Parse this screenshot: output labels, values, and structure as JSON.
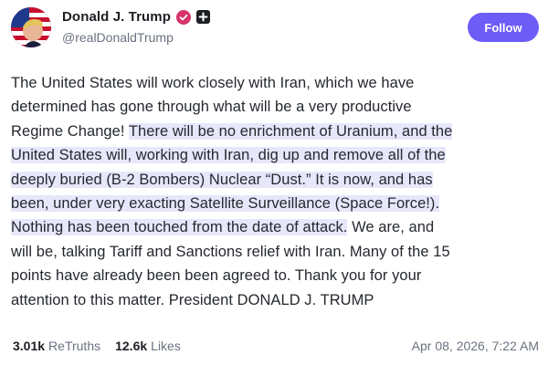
{
  "author": {
    "display_name": "Donald J. Trump",
    "handle": "@realDonaldTrump",
    "verified_icon": "verified-badge-icon",
    "group_icon": "plus-badge-icon"
  },
  "follow_label": "Follow",
  "post": {
    "lines": [
      {
        "pre": "The United States will work closely with Iran, which we have",
        "hl": "",
        "post": ""
      },
      {
        "pre": "determined has gone through what will be a very productive",
        "hl": "",
        "post": ""
      },
      {
        "pre": "Regime Change! ",
        "hl": "There will be no enrichment of Uranium, and the",
        "post": ""
      },
      {
        "pre": "",
        "hl": "United States will, working with Iran, dig up and remove all of the",
        "post": ""
      },
      {
        "pre": "",
        "hl": "deeply buried (B-2 Bombers) Nuclear “Dust.” It is now, and has",
        "post": ""
      },
      {
        "pre": "",
        "hl": "been, under very exacting Satellite Surveillance (Space Force!).",
        "post": ""
      },
      {
        "pre": "",
        "hl": "Nothing has been touched from the date of attack.",
        "post": " We are, and"
      },
      {
        "pre": "will be, talking Tariff and Sanctions relief with Iran. Many of the 15",
        "hl": "",
        "post": ""
      },
      {
        "pre": "points have already been been agreed to. Thank you for your",
        "hl": "",
        "post": ""
      },
      {
        "pre": "attention to this matter. President DONALD J. TRUMP",
        "hl": "",
        "post": ""
      }
    ]
  },
  "stats": {
    "retruths_count": "3.01k",
    "retruths_label": "ReTruths",
    "likes_count": "12.6k",
    "likes_label": "Likes"
  },
  "timestamp": "Apr 08, 2026, 7:22 AM",
  "colors": {
    "accent": "#6e5cf6",
    "highlight": "#e7e7fb",
    "verified": "#d6336c"
  }
}
